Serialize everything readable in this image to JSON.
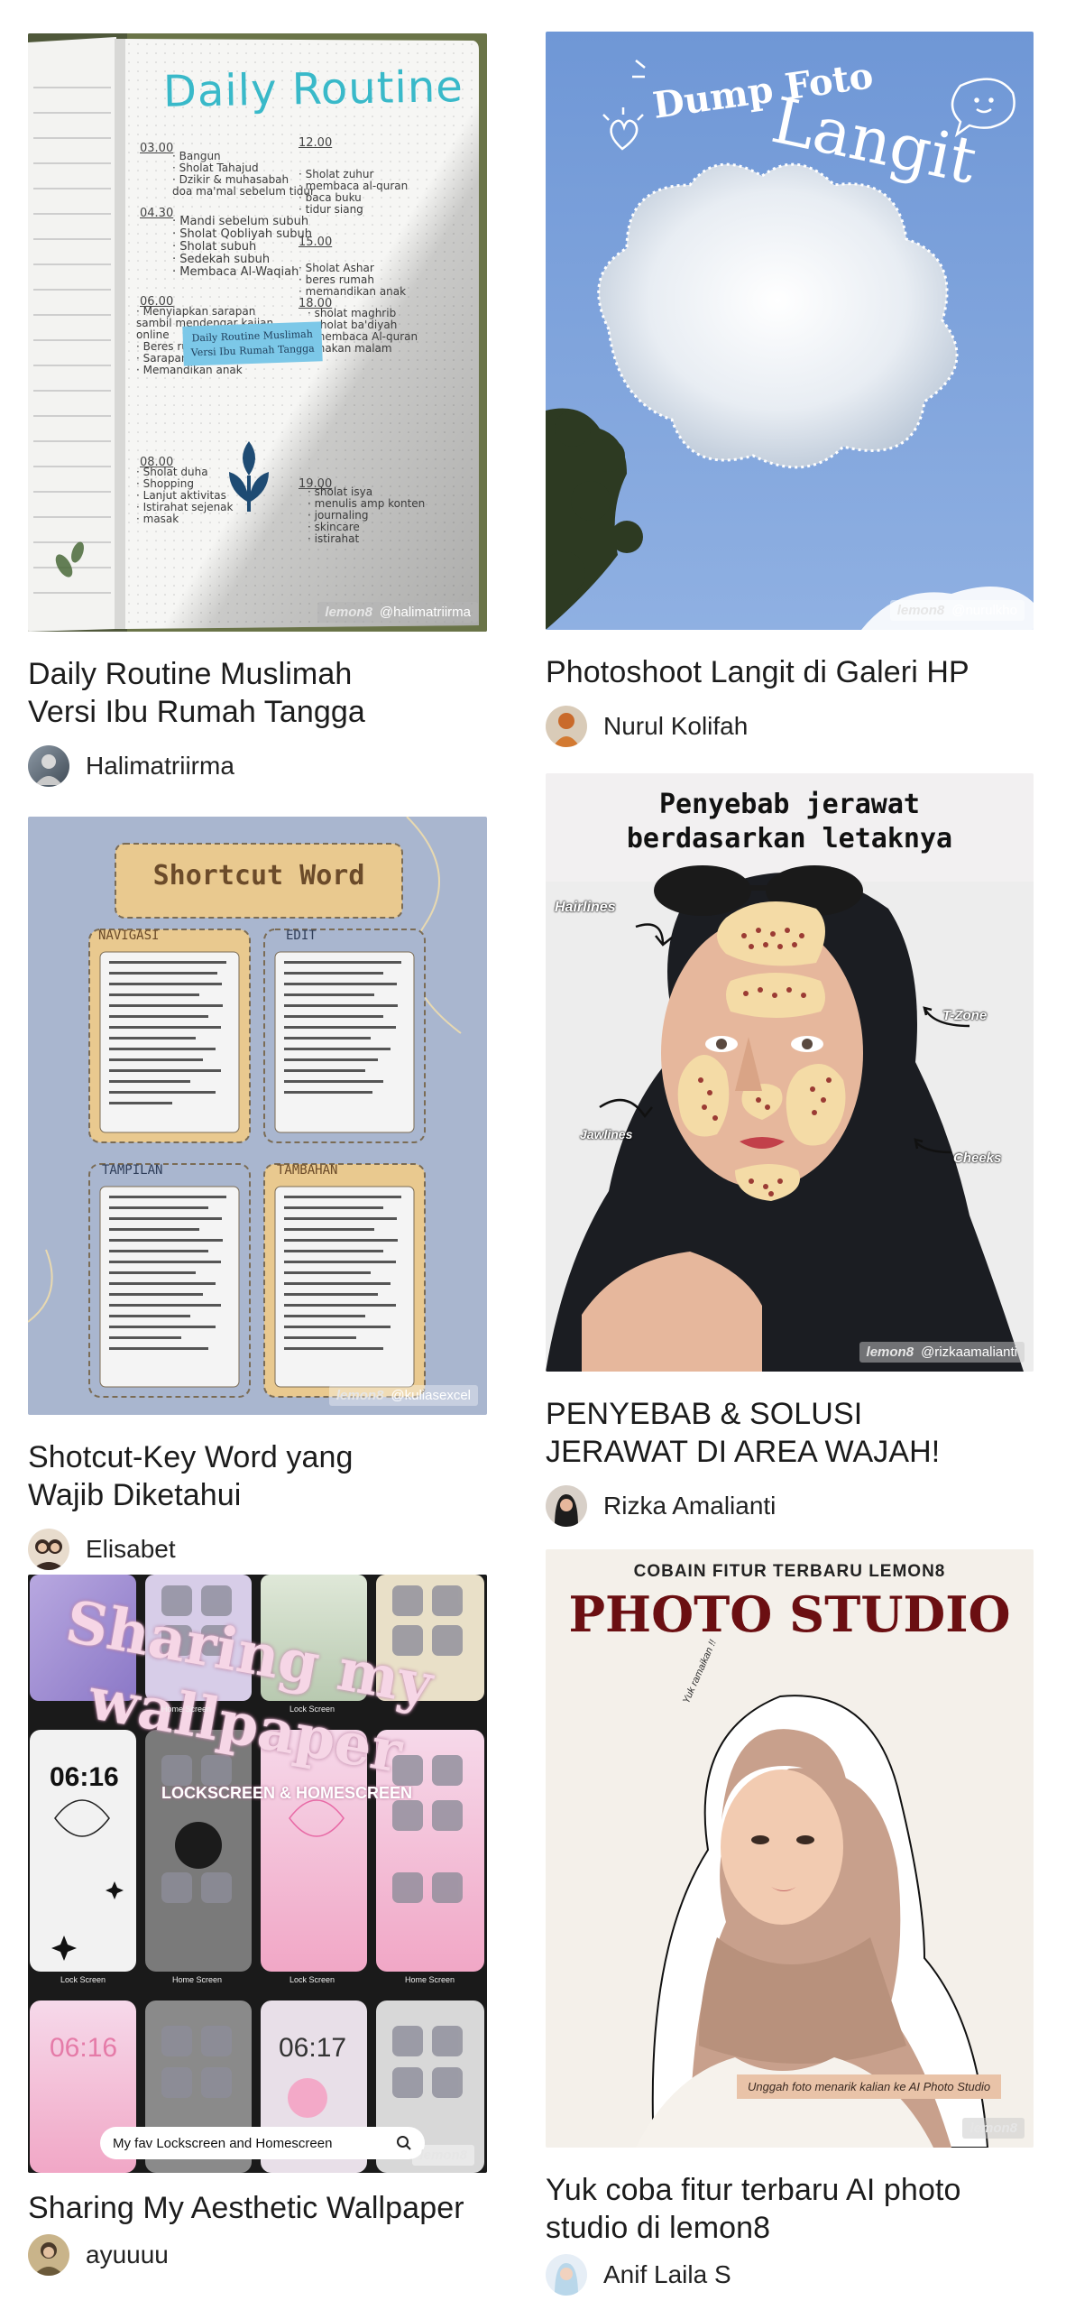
{
  "feed": {
    "left": [
      {
        "title_lines": [
          "Daily Routine Muslimah",
          "Versi Ibu Rumah Tangga"
        ],
        "author": "Halimatriirma",
        "image": {
          "heading": "Daily Routine",
          "sticker_lines": [
            "Daily Routine Muslimah",
            "Versi Ibu Rumah Tangga"
          ],
          "times": [
            "03.00",
            "12.00",
            "04.30",
            "15.00",
            "06.00",
            "18.00",
            "08.00",
            "19.00"
          ],
          "watermark_brand": "lemon8",
          "watermark_handle": "@halimatriirma"
        }
      },
      {
        "title_lines": [
          "Shotcut-Key Word yang",
          "Wajib Diketahui"
        ],
        "author": "Elisabet",
        "image": {
          "heading": "Shortcut Word",
          "sections": [
            "NAVIGASI",
            "EDIT",
            "TAMPILAN",
            "TAMBAHAN"
          ],
          "watermark_brand": "lemon8",
          "watermark_handle": "@kuliasexcel"
        }
      },
      {
        "title_lines": [
          "Sharing My Aesthetic Wallpaper"
        ],
        "author": "ayuuuu",
        "image": {
          "heading_1": "Sharing my",
          "heading_2": "wallpaper",
          "subheading": "LOCKSCREEN & HOMESCREEN",
          "labels": [
            "Home Screen",
            "Lock Screen",
            "Lock Screen",
            "Home Screen",
            "Lock Screen",
            "Home Screen"
          ],
          "clock_1": "06:16",
          "clock_2": "06:17",
          "clock_3": "06:16",
          "search_text": "My fav Lockscreen and Homescreen",
          "watermark_brand": "lemon8"
        }
      }
    ],
    "right": [
      {
        "title_lines": [
          "Photoshoot Langit di Galeri HP"
        ],
        "author": "Nurul Kolifah",
        "image": {
          "heading_1": "Dump Foto",
          "heading_2": "Langit",
          "watermark_brand": "lemon8",
          "watermark_handle": "@nurulkho"
        }
      },
      {
        "title_lines": [
          "PENYEBAB & SOLUSI",
          "JERAWAT DI AREA WAJAH!"
        ],
        "author": "Rizka Amalianti",
        "image": {
          "heading_1": "Penyebab jerawat",
          "heading_2": "berdasarkan letaknya",
          "labels": [
            "Hairlines",
            "T-Zone",
            "Jawlines",
            "Cheeks"
          ],
          "watermark_brand": "lemon8",
          "watermark_handle": "@rizkaamalianti"
        }
      },
      {
        "title_lines": [
          "Yuk coba fitur terbaru AI photo",
          "studio di lemon8"
        ],
        "author": "Anif Laila S",
        "image": {
          "kicker": "COBAIN FITUR TERBARU LEMON8",
          "heading": "PHOTO STUDIO",
          "side_note": "Yuk ramaikan !!",
          "caption": "Unggah foto menarik kalian ke AI Photo Studio",
          "watermark_brand": "lemon8"
        }
      }
    ]
  },
  "colors": {
    "routine_heading": "#39b9c9",
    "shortcut_bg": "#a9b6cf",
    "sky_blue": "#6f97d6",
    "studio_red": "#6b0f12",
    "studio_bg": "#f4f0ea"
  }
}
